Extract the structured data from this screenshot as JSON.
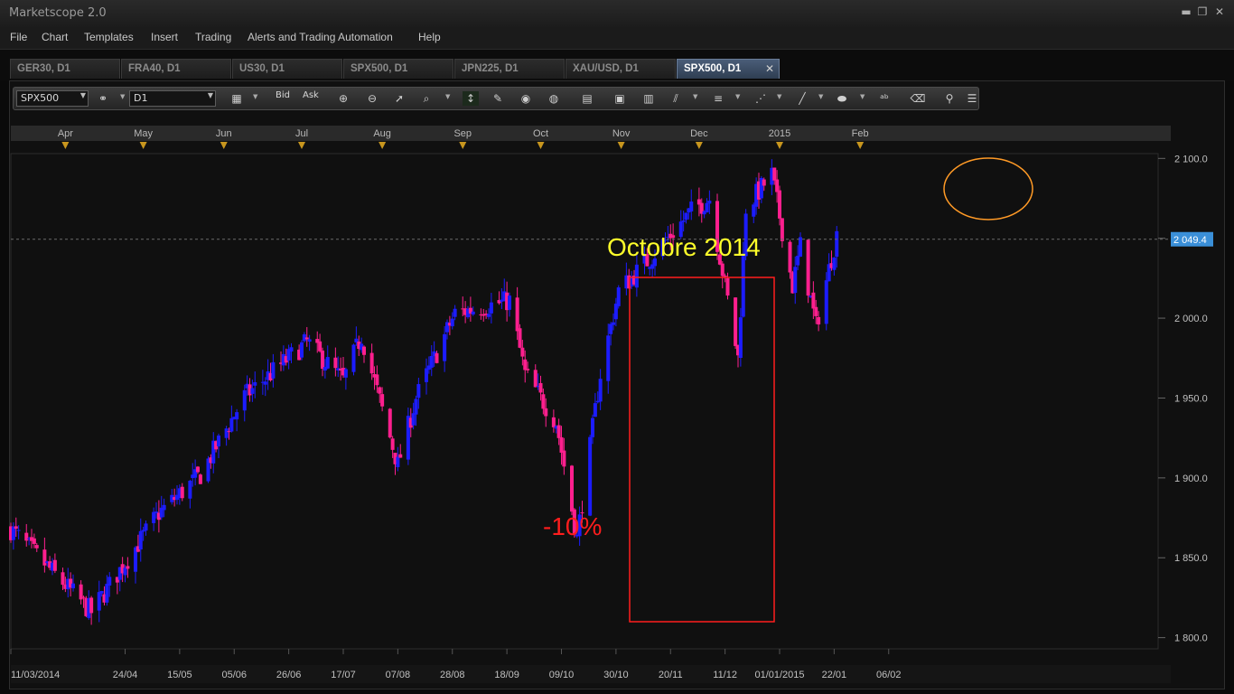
{
  "app": {
    "title": "Marketscope 2.0"
  },
  "window_controls": {
    "minimize": "▬",
    "restore": "❐",
    "close": "✕"
  },
  "menu": [
    "File",
    "Chart",
    "Templates",
    "Insert",
    "Trading",
    "Alerts and Trading Automation",
    "Help"
  ],
  "tabs": [
    {
      "label": "GER30, D1",
      "active": false
    },
    {
      "label": "FRA40, D1",
      "active": false
    },
    {
      "label": "US30, D1",
      "active": false
    },
    {
      "label": "SPX500, D1",
      "active": false
    },
    {
      "label": "JPN225, D1",
      "active": false
    },
    {
      "label": "XAU/USD, D1",
      "active": false
    },
    {
      "label": "SPX500, D1",
      "active": true,
      "close": "✕"
    }
  ],
  "pane_controls": {
    "restore": "❐",
    "close": "✕"
  },
  "toolbar": {
    "instrument": "SPX500",
    "timeframe": "D1",
    "bid_label": "Bid",
    "ask_label": "Ask",
    "icons": [
      "chart-type-icon",
      "crosshair-icon",
      "zoom-in-icon",
      "zoom-out-icon",
      "pointer-icon",
      "zoom-area-icon",
      "cursor-icon",
      "note-icon",
      "eye-icon",
      "globe-icon",
      "ruler-icon",
      "image-icon",
      "properties-icon",
      "line-tool-icon",
      "fibonacci-icon",
      "pitchfork-icon",
      "pen-icon",
      "ellipse-icon",
      "text-icon",
      "eraser-icon",
      "indicators-icon",
      "more-icon"
    ]
  },
  "colors": {
    "bull": "#1c1cff",
    "bear": "#ff1f8e",
    "background": "#101010",
    "annotation_title": "#ffff2a",
    "annotation_box": "#ff1d1d",
    "annotation_ellipse": "#ff9a26",
    "price_label_bg": "#3a8fd8"
  },
  "chart_data": {
    "type": "candlestick",
    "instrument": "SPX500",
    "timeframe": "D1",
    "ylim": [
      1793,
      2103
    ],
    "y_ticks": [
      "2 100.0",
      "2 050.0",
      "2 000.0",
      "1 950.0",
      "1 900.0",
      "1 850.0",
      "1 800.0"
    ],
    "y_tick_values": [
      2100,
      2050,
      2000,
      1950,
      1900,
      1850,
      1800
    ],
    "x_ticks": [
      "11/03/2014",
      "24/04",
      "15/05",
      "05/06",
      "26/06",
      "17/07",
      "07/08",
      "28/08",
      "18/09",
      "09/10",
      "30/10",
      "20/11",
      "11/12",
      "01/01/2015",
      "22/01",
      "06/02"
    ],
    "month_labels": [
      "Apr",
      "May",
      "Jun",
      "Jul",
      "Aug",
      "Sep",
      "Oct",
      "Nov",
      "Dec",
      "2015",
      "Feb"
    ],
    "current_price": "2 049.4",
    "current_price_value": 2049.4,
    "annotations": {
      "title": "Octobre 2014",
      "drawdown": "-10%"
    },
    "period": {
      "start": "2014-03-11",
      "end": "2015-01-23"
    },
    "anchors": [
      {
        "date": "2014-03-11",
        "close": 1868
      },
      {
        "date": "2014-04-11",
        "close": 1816
      },
      {
        "date": "2014-05-07",
        "close": 1878
      },
      {
        "date": "2014-05-23",
        "close": 1902
      },
      {
        "date": "2014-06-09",
        "close": 1951
      },
      {
        "date": "2014-07-03",
        "close": 1985
      },
      {
        "date": "2014-07-17",
        "close": 1961
      },
      {
        "date": "2014-07-24",
        "close": 1989
      },
      {
        "date": "2014-08-07",
        "close": 1908
      },
      {
        "date": "2014-08-14",
        "close": 1950
      },
      {
        "date": "2014-08-29",
        "close": 2003
      },
      {
        "date": "2014-09-19",
        "close": 2011
      },
      {
        "date": "2014-09-25",
        "close": 1965
      },
      {
        "date": "2014-10-07",
        "close": 1935
      },
      {
        "date": "2014-10-15",
        "close": 1862
      },
      {
        "date": "2014-10-24",
        "close": 1965
      },
      {
        "date": "2014-10-31",
        "close": 2017
      },
      {
        "date": "2014-11-13",
        "close": 2039
      },
      {
        "date": "2014-11-28",
        "close": 2067
      },
      {
        "date": "2014-12-05",
        "close": 2075
      },
      {
        "date": "2014-12-16",
        "close": 1975
      },
      {
        "date": "2014-12-19",
        "close": 2069
      },
      {
        "date": "2014-12-29",
        "close": 2090
      },
      {
        "date": "2015-01-06",
        "close": 2020
      },
      {
        "date": "2015-01-09",
        "close": 2045
      },
      {
        "date": "2015-01-15",
        "close": 1995
      },
      {
        "date": "2015-01-23",
        "close": 2052
      }
    ]
  }
}
